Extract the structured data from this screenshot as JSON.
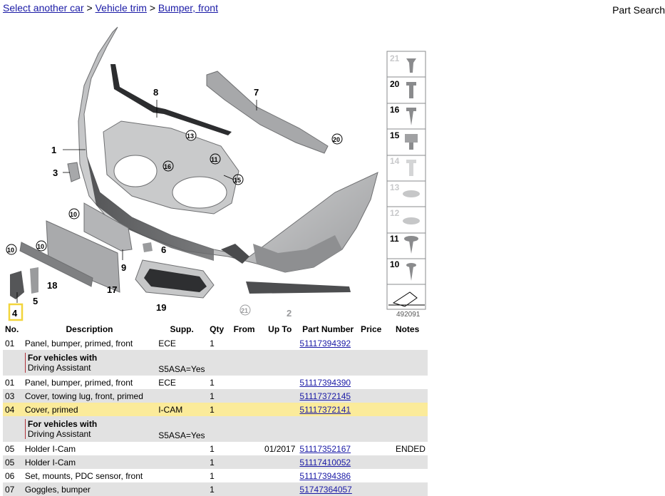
{
  "breadcrumb": {
    "items": [
      {
        "label": "Select another car"
      },
      {
        "label": "Vehicle trim"
      },
      {
        "label": "Bumper, front"
      }
    ],
    "separator": ">"
  },
  "header": {
    "part_search_label": "Part Search"
  },
  "diagram": {
    "image_number": "492091",
    "callouts": [
      "1",
      "2",
      "3",
      "4",
      "5",
      "6",
      "7",
      "8",
      "9",
      "10",
      "11",
      "13",
      "15",
      "16",
      "17",
      "18",
      "19",
      "20",
      "21"
    ],
    "highlighted_callout": "4",
    "highlight_color": "#f2d53c",
    "legend_items": [
      "21",
      "20",
      "16",
      "15",
      "14",
      "13",
      "12",
      "11",
      "10"
    ]
  },
  "table": {
    "columns": [
      "No.",
      "Description",
      "Supp.",
      "Qty",
      "From",
      "Up To",
      "Part Number",
      "Price",
      "Notes"
    ],
    "rows": [
      {
        "type": "part",
        "style": "white",
        "no": "01",
        "description": "Panel, bumper, primed, front",
        "supp": "ECE",
        "qty": "1",
        "from": "",
        "upto": "",
        "part_number": "51117394392",
        "price": "",
        "notes": ""
      },
      {
        "type": "note",
        "style": "grey",
        "head": "For vehicles with",
        "text": "Driving Assistant",
        "supp": "S5ASA=Yes"
      },
      {
        "type": "part",
        "style": "white",
        "no": "01",
        "description": "Panel, bumper, primed, front",
        "supp": "ECE",
        "qty": "1",
        "from": "",
        "upto": "",
        "part_number": "51117394390",
        "price": "",
        "notes": ""
      },
      {
        "type": "part",
        "style": "grey",
        "no": "03",
        "description": "Cover, towing lug, front, primed",
        "supp": "",
        "qty": "1",
        "from": "",
        "upto": "",
        "part_number": "51117372145",
        "price": "",
        "notes": ""
      },
      {
        "type": "part",
        "style": "hl",
        "no": "04",
        "description": "Cover, primed",
        "supp": "I-CAM",
        "qty": "1",
        "from": "",
        "upto": "",
        "part_number": "51117372141",
        "price": "",
        "notes": ""
      },
      {
        "type": "note",
        "style": "grey",
        "head": "For vehicles with",
        "text": "Driving Assistant",
        "supp": "S5ASA=Yes"
      },
      {
        "type": "part",
        "style": "white",
        "no": "05",
        "description": "Holder I-Cam",
        "supp": "",
        "qty": "1",
        "from": "",
        "upto": "01/2017",
        "part_number": "51117352167",
        "price": "",
        "notes": "ENDED"
      },
      {
        "type": "part",
        "style": "grey",
        "no": "05",
        "description": "Holder I-Cam",
        "supp": "",
        "qty": "1",
        "from": "",
        "upto": "",
        "part_number": "51117410052",
        "price": "",
        "notes": ""
      },
      {
        "type": "part",
        "style": "white",
        "no": "06",
        "description": "Set, mounts, PDC sensor, front",
        "supp": "",
        "qty": "1",
        "from": "",
        "upto": "",
        "part_number": "51117394386",
        "price": "",
        "notes": ""
      },
      {
        "type": "part",
        "style": "grey",
        "no": "07",
        "description": "Goggles, bumper",
        "supp": "",
        "qty": "1",
        "from": "",
        "upto": "",
        "part_number": "51747364057",
        "price": "",
        "notes": ""
      }
    ]
  }
}
